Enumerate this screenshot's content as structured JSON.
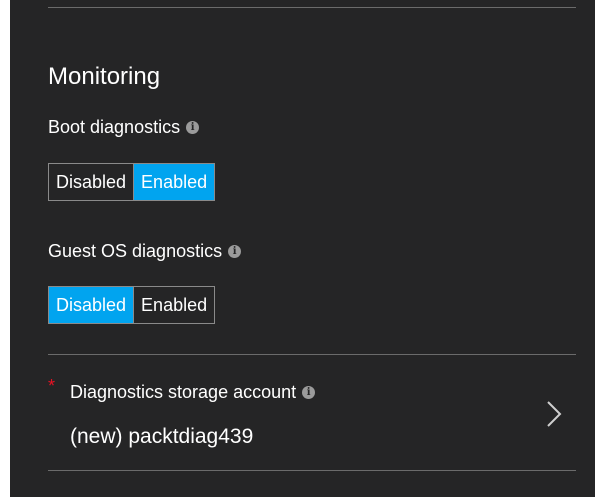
{
  "monitoring": {
    "title": "Monitoring"
  },
  "boot_diagnostics": {
    "label": "Boot diagnostics",
    "options": [
      "Disabled",
      "Enabled"
    ],
    "selected": "Enabled"
  },
  "guest_os_diagnostics": {
    "label": "Guest OS diagnostics",
    "options": [
      "Disabled",
      "Enabled"
    ],
    "selected": "Disabled"
  },
  "storage_account": {
    "required_marker": "*",
    "label": "Diagnostics storage account",
    "value": "(new) packtdiag439"
  },
  "icons": {
    "info": "info-icon",
    "chevron": "chevron-right-icon"
  },
  "colors": {
    "panel_background": "#252526",
    "selected_option": "#01a4ef",
    "required_marker": "#e81123",
    "divider": "#6b6b6b"
  }
}
